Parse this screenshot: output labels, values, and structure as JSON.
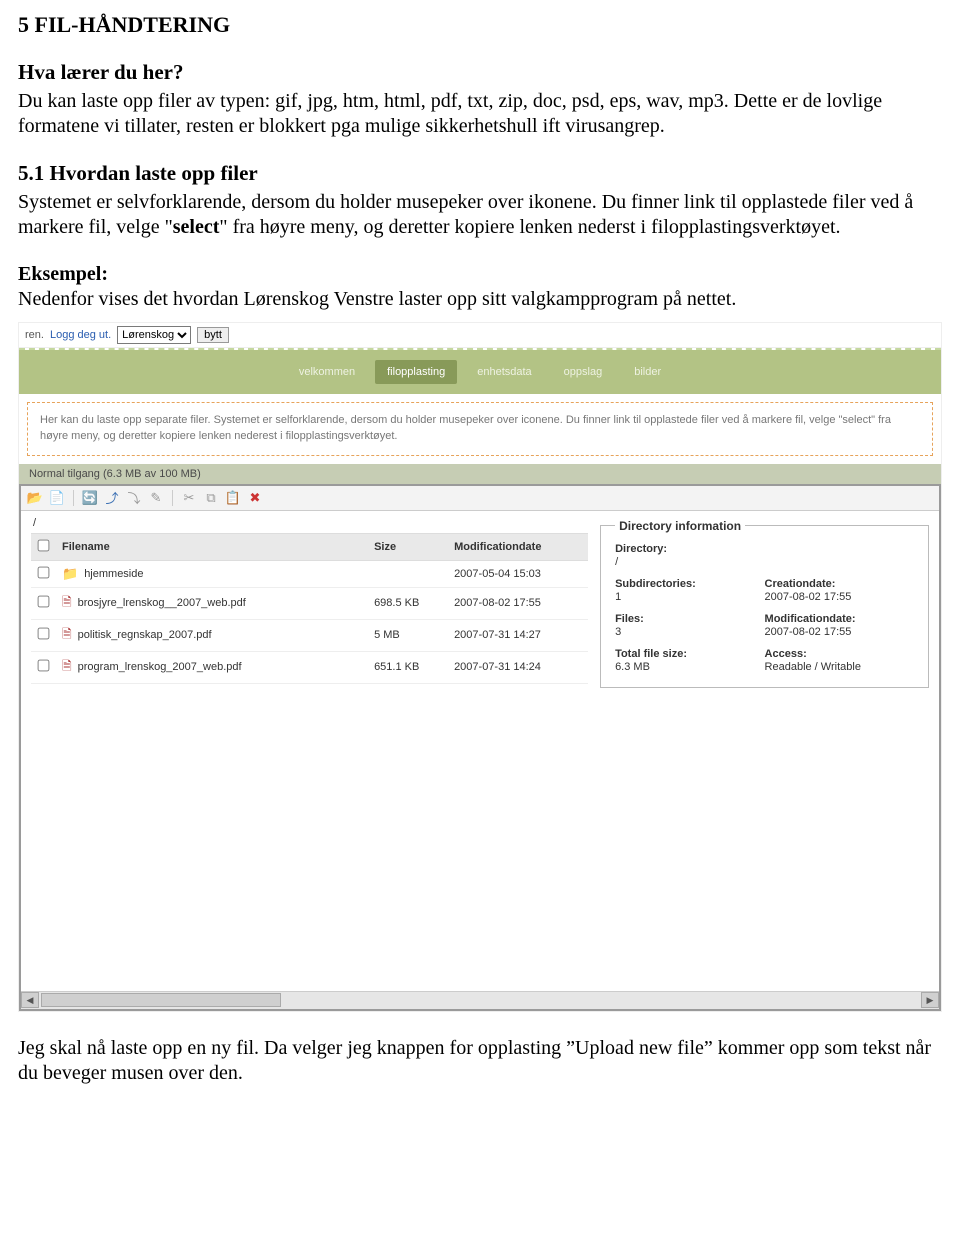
{
  "doc": {
    "section_title": "5 FIL-HÅNDTERING",
    "sub1_title": "Hva lærer du her?",
    "sub1_body": "Du kan laste opp filer av typen: gif, jpg, htm, html, pdf, txt, zip, doc, psd, eps, wav, mp3. Dette er de lovlige formatene vi tillater, resten er blokkert pga mulige sikkerhetshull ift virusangrep.",
    "sub2_title": "5.1 Hvordan laste opp filer",
    "sub2_body_a": "Systemet er selvforklarende, dersom du holder musepeker over ikonene. Du finner link til opplastede filer ved å markere fil, velge \"",
    "sub2_body_bold": "select",
    "sub2_body_b": "\" fra høyre meny, og deretter kopiere lenken nederst i filopplastingsverktøyet.",
    "eksempel_label": "Eksempel:",
    "eksempel_body": "Nedenfor vises det hvordan Lørenskog Venstre laster opp sitt valgkampprogram på nettet.",
    "after_body": "Jeg skal nå laste opp en ny fil. Da velger jeg knappen for opplasting ”Upload new file” kommer opp som tekst når du beveger musen over den."
  },
  "app": {
    "top": {
      "prefix": "ren.",
      "logout_link": "Logg deg ut.",
      "dropdown_selected": "Lørenskog",
      "button": "bytt"
    },
    "tabs": [
      {
        "label": "velkommen",
        "active": false
      },
      {
        "label": "filopplasting",
        "active": true
      },
      {
        "label": "enhetsdata",
        "active": false
      },
      {
        "label": "oppslag",
        "active": false
      },
      {
        "label": "bilder",
        "active": false
      }
    ],
    "info_text": "Her kan du laste opp separate filer. Systemet er selforklarende, dersom du holder musepeker over iconene. Du finner link til opplastede filer ved å markere fil, velge \"select\" fra høyre meny, og deretter kopiere lenken nederest i filopplastingsverktøyet.",
    "quota_line": "Normal tilgang (6.3 MB av 100 MB)",
    "path": "/",
    "columns": {
      "name": "Filename",
      "size": "Size",
      "date": "Modificationdate"
    },
    "files": [
      {
        "type": "folder",
        "name": "hjemmeside",
        "size": "",
        "date": "2007-05-04 15:03"
      },
      {
        "type": "file",
        "name": "brosjyre_lrenskog__2007_web.pdf",
        "size": "698.5 KB",
        "date": "2007-08-02 17:55"
      },
      {
        "type": "file",
        "name": "politisk_regnskap_2007.pdf",
        "size": "5 MB",
        "date": "2007-07-31 14:27"
      },
      {
        "type": "file",
        "name": "program_lrenskog_2007_web.pdf",
        "size": "651.1 KB",
        "date": "2007-07-31 14:24"
      }
    ],
    "dirinfo": {
      "legend": "Directory information",
      "directory_label": "Directory:",
      "directory_value": "/",
      "subdirs_label": "Subdirectories:",
      "subdirs_value": "1",
      "created_label": "Creationdate:",
      "created_value": "2007-08-02 17:55",
      "files_label": "Files:",
      "files_value": "3",
      "modified_label": "Modificationdate:",
      "modified_value": "2007-08-02 17:55",
      "total_label": "Total file size:",
      "total_value": "6.3 MB",
      "access_label": "Access:",
      "access_value": "Readable / Writable"
    }
  }
}
